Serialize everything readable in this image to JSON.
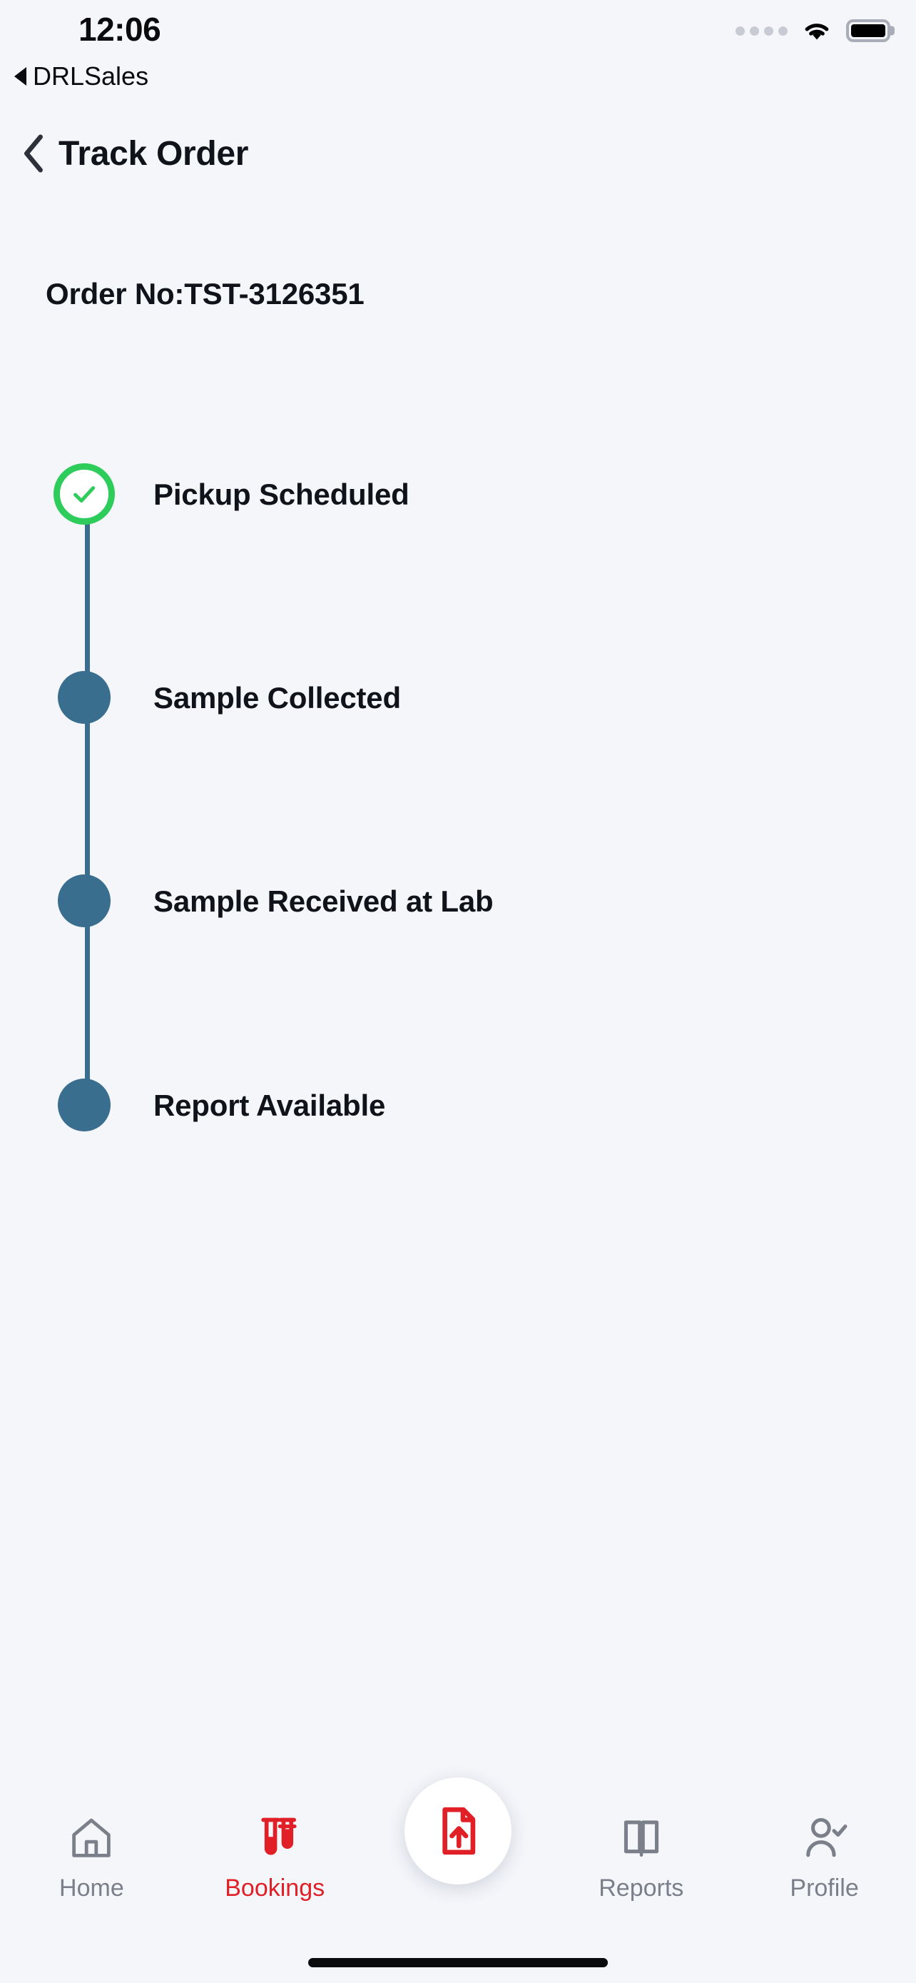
{
  "status_bar": {
    "time": "12:06",
    "cellular_icon": "cellular-dots-icon",
    "wifi_icon": "wifi-icon",
    "battery_icon": "battery-full-icon"
  },
  "return_app": {
    "icon": "back-triangle-icon",
    "label": "DRLSales"
  },
  "header": {
    "back_icon": "chevron-left-icon",
    "title": "Track Order"
  },
  "order": {
    "label": "Order No:TST-3126351"
  },
  "timeline": {
    "line_color": "#3a6e8f",
    "done_color": "#2ecc5a",
    "pending_color": "#3a6e8f",
    "steps": [
      {
        "label": "Pickup Scheduled",
        "state": "done",
        "icon": "check-circle-icon"
      },
      {
        "label": "Sample Collected",
        "state": "pending",
        "icon": "dot-icon"
      },
      {
        "label": "Sample Received at Lab",
        "state": "pending",
        "icon": "dot-icon"
      },
      {
        "label": "Report Available",
        "state": "pending",
        "icon": "dot-icon"
      }
    ]
  },
  "tabbar": {
    "active_color": "#e01f26",
    "inactive_color": "#7b7f8a",
    "items": [
      {
        "label": "Home",
        "icon": "home-icon",
        "active": false
      },
      {
        "label": "Bookings",
        "icon": "test-tubes-icon",
        "active": true
      },
      {
        "label": "Reports",
        "icon": "book-open-icon",
        "active": false
      },
      {
        "label": "Profile",
        "icon": "user-check-icon",
        "active": false
      }
    ],
    "fab": {
      "icon": "document-upload-icon"
    }
  }
}
